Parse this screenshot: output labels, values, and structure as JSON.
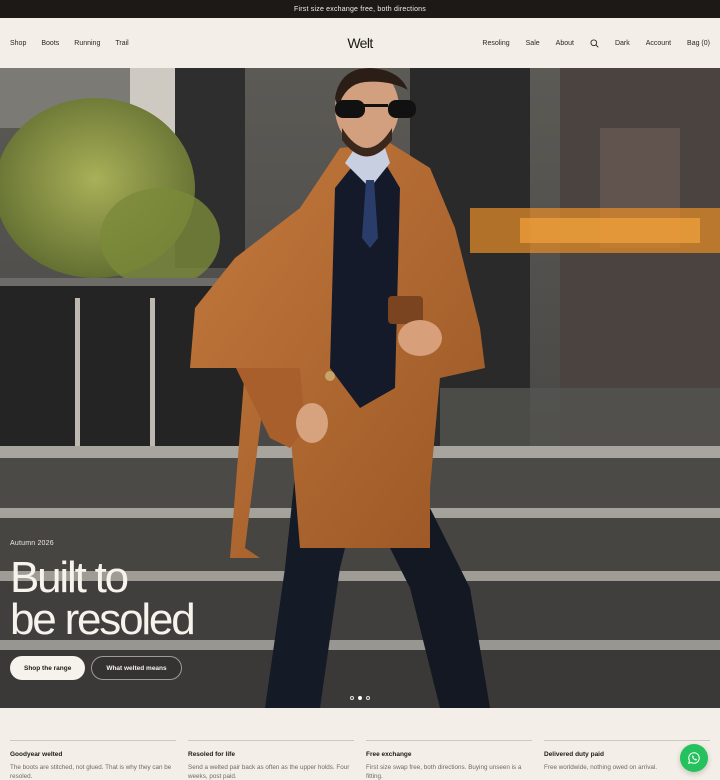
{
  "announcement": "First size exchange free, both directions",
  "header": {
    "logo": "Welt",
    "nav_left": [
      "Shop",
      "Boots",
      "Running",
      "Trail"
    ],
    "nav_right": {
      "resoling": "Resoling",
      "sale": "Sale",
      "about": "About",
      "dark": "Dark",
      "account": "Account",
      "bag": "Bag (0)"
    }
  },
  "hero": {
    "eyebrow": "Autumn 2026",
    "headline_line1": "Built to",
    "headline_line2": "be resoled",
    "primary_cta": "Shop the range",
    "secondary_cta": "What welted means",
    "slides": 3,
    "active_slide": 2
  },
  "features": [
    {
      "title": "Goodyear welted",
      "text": "The boots are stitched, not glued. That is why they can be resoled."
    },
    {
      "title": "Resoled for life",
      "text": "Send a welted pair back as often as the upper holds. Four weeks, post paid."
    },
    {
      "title": "Free exchange",
      "text": "First size swap free, both directions. Buying unseen is a fitting."
    },
    {
      "title": "Delivered duty paid",
      "text": "Free worldwide, nothing owed on arrival."
    }
  ],
  "icons": {
    "search": "search-icon",
    "chat": "whatsapp-icon"
  },
  "colors": {
    "background": "#f3efe8",
    "announcement_bar": "#1c1916",
    "chat_button": "#25c15c"
  }
}
